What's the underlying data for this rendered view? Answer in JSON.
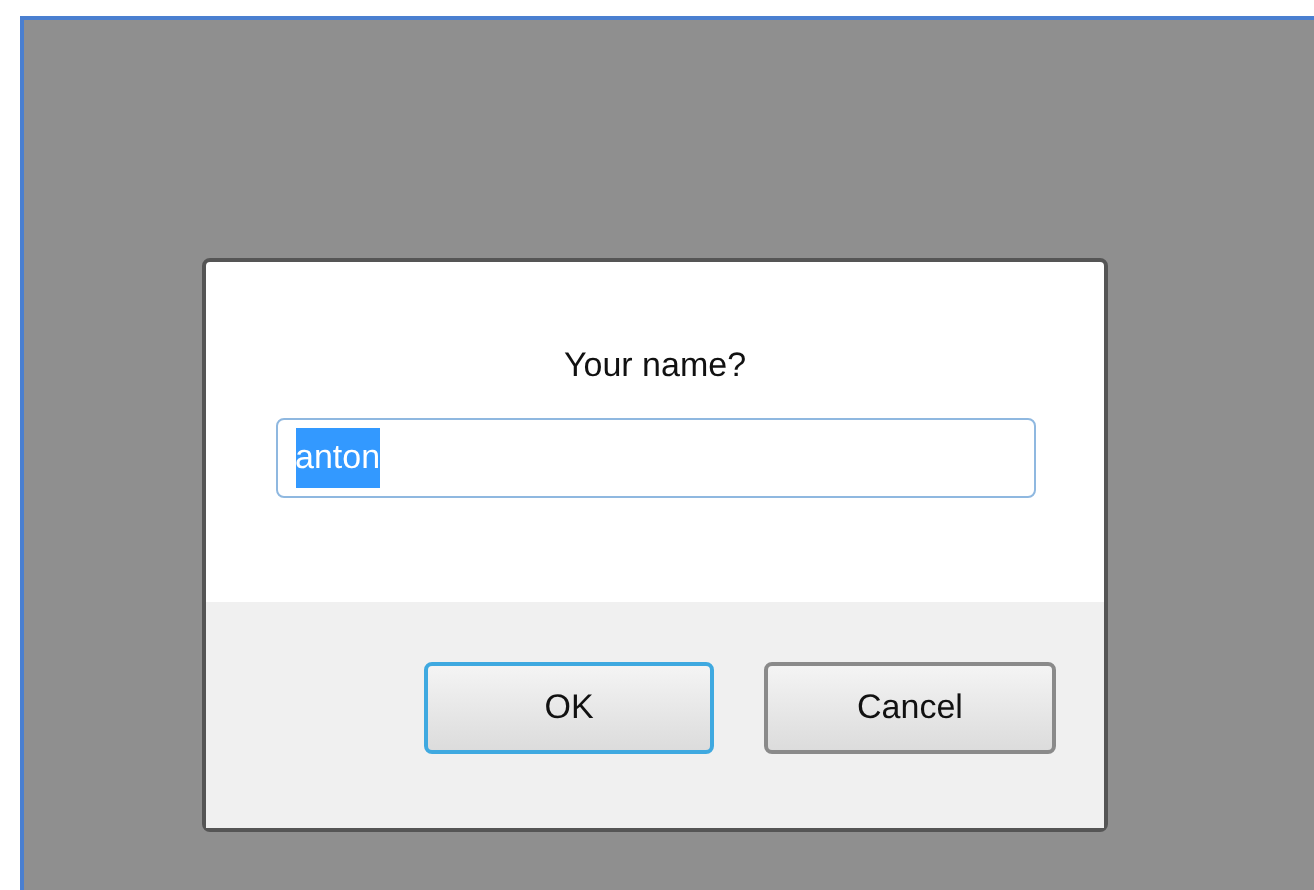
{
  "dialog": {
    "prompt": "Your name?",
    "field": {
      "value": "anton",
      "value_selected": true
    },
    "buttons": [
      {
        "label": "OK",
        "focused": true
      },
      {
        "label": "Cancel",
        "focused": false
      }
    ]
  }
}
